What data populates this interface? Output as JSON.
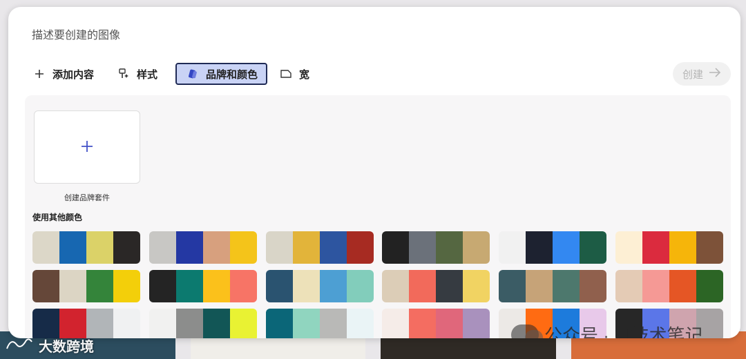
{
  "prompt": {
    "placeholder": "描述要创建的图像"
  },
  "toolbar": {
    "add_content": "添加内容",
    "style": "样式",
    "brand_colors": "品牌和颜色",
    "wide": "宽",
    "create": "创建"
  },
  "panel": {
    "create_kit_label": "创建品牌套件",
    "other_colors_title": "使用其他颜色",
    "palettes": [
      [
        "#dcd7c8",
        "#1767b1",
        "#dbd268",
        "#2a2726"
      ],
      [
        "#c8c7c4",
        "#2438a3",
        "#d7a07e",
        "#f4c41a"
      ],
      [
        "#d9d5c8",
        "#e2b43a",
        "#2d55a0",
        "#a72b22"
      ],
      [
        "#222222",
        "#6b717a",
        "#556741",
        "#c7a972"
      ],
      [
        "#f1f1f1",
        "#1d2230",
        "#3388f1",
        "#1d5c45"
      ],
      [
        "#fdefd4",
        "#db2b3e",
        "#f6b50a",
        "#7d5239"
      ],
      [
        "#654739",
        "#dcd5c4",
        "#34843a",
        "#f3cf0a"
      ],
      [
        "#242424",
        "#0c7a6f",
        "#fbc11b",
        "#f77466"
      ],
      [
        "#2a5370",
        "#ede1b9",
        "#4d9fd3",
        "#82cdbb"
      ],
      [
        "#dccdb7",
        "#f26a5b",
        "#363b41",
        "#f1d362"
      ],
      [
        "#3b5c65",
        "#c6a378",
        "#4d786d",
        "#90604d"
      ],
      [
        "#e4cbb5",
        "#f59995",
        "#e55625",
        "#2c6525"
      ],
      [
        "#162b48",
        "#d2232e",
        "#b1b5b8",
        "#f0f1f2"
      ],
      [
        "#f1f1f0",
        "#8c8d8c",
        "#125656",
        "#e9f233"
      ],
      [
        "#0b6678",
        "#90d5bf",
        "#b9b9b7",
        "#eaf4f6"
      ],
      [
        "#f5ece8",
        "#f46d61",
        "#e0677b",
        "#a991bd"
      ],
      [
        "#ece9e6",
        "#ff6b12",
        "#1d7bdc",
        "#e8c9ea"
      ],
      [
        "#272727",
        "#5b76e8",
        "#cfa4ae",
        "#a7a3a4"
      ]
    ]
  },
  "watermarks": {
    "right": "公众号 · AI技术笔记",
    "left": "大数跨境"
  },
  "colors": {
    "accent": "#4250c8",
    "active_tab_bg": "#c9d3f5",
    "active_tab_border": "#1f2a55"
  },
  "background_tiles": [
    "#2c4d5f",
    "#f0eee9",
    "#2f2a25",
    "#d86d3a"
  ]
}
